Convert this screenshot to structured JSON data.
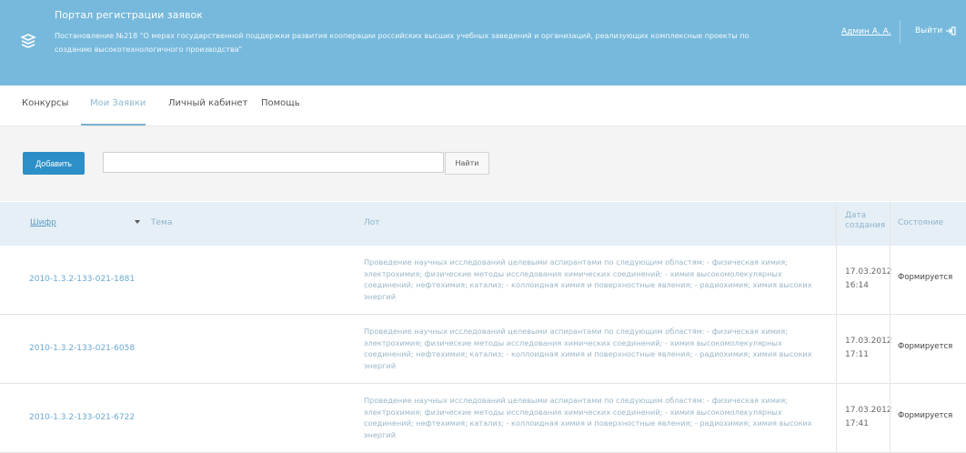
{
  "header": {
    "title": "Портал регистрации заявок",
    "description": "Постановление №218 \"О мерах государственной поддержки развития кооперации российских высших учебных заведений и организаций, реализующих комплексные проекты по созданию высокотехнологичного производства\"",
    "user": "Админ А. А.",
    "logout": "Выйти",
    "logo_icon": "book-stack-icon",
    "logout_icon": "logout-arrow-icon"
  },
  "tabs": [
    "Конкурсы",
    "Мои Заявки",
    "Личный кабинет",
    "Помощь"
  ],
  "active_tab": 1,
  "toolbar": {
    "add_label": "Добавить",
    "search_value": "",
    "find_label": "Найти"
  },
  "table": {
    "columns": [
      "Шифр",
      "Тема",
      "Лот",
      "Дата создания",
      "Состояние"
    ],
    "rows": [
      {
        "id": "2010-1.3.2-133-021-1881",
        "topic": "",
        "lot": "Проведение научных исследований целевыми аспирантами по следующим областям: - физическая химия; электрохимия; физические методы исследования химических соединений; - химия высокомолекулярных соединений; нефтехимия; катализ; - коллоидная химия и поверхностные явления; - радиохимия; химия высоких энергий",
        "date": "17.03.2012",
        "time": "16:14",
        "status": "Формируется"
      },
      {
        "id": "2010-1.3.2-133-021-6058",
        "topic": "",
        "lot": "Проведение научных исследований целевыми аспирантами по следующим областям: - физическая химия; электрохимия; физические методы исследования химических соединений; - химия высокомолекулярных соединений; нефтехимия; катализ; - коллоидная химия и поверхностные явления; - радиохимия; химия высоких энергий",
        "date": "17.03.2012",
        "time": "17:11",
        "status": "Формируется"
      },
      {
        "id": "2010-1.3.2-133-021-6722",
        "topic": "",
        "lot": "Проведение научных исследований целевыми аспирантами по следующим областям: - физическая химия; электрохимия; физические методы исследования химических соединений; - химия высокомолекулярных соединений; нефтехимия; катализ; - коллоидная химия и поверхностные явления; - радиохимия; химия высоких энергий",
        "date": "17.03.2012",
        "time": "17:41",
        "status": "Формируется"
      }
    ]
  },
  "colors": {
    "header_bg": "#76b9dc",
    "accent": "#2c8fc8",
    "link": "#6aa8cf"
  }
}
